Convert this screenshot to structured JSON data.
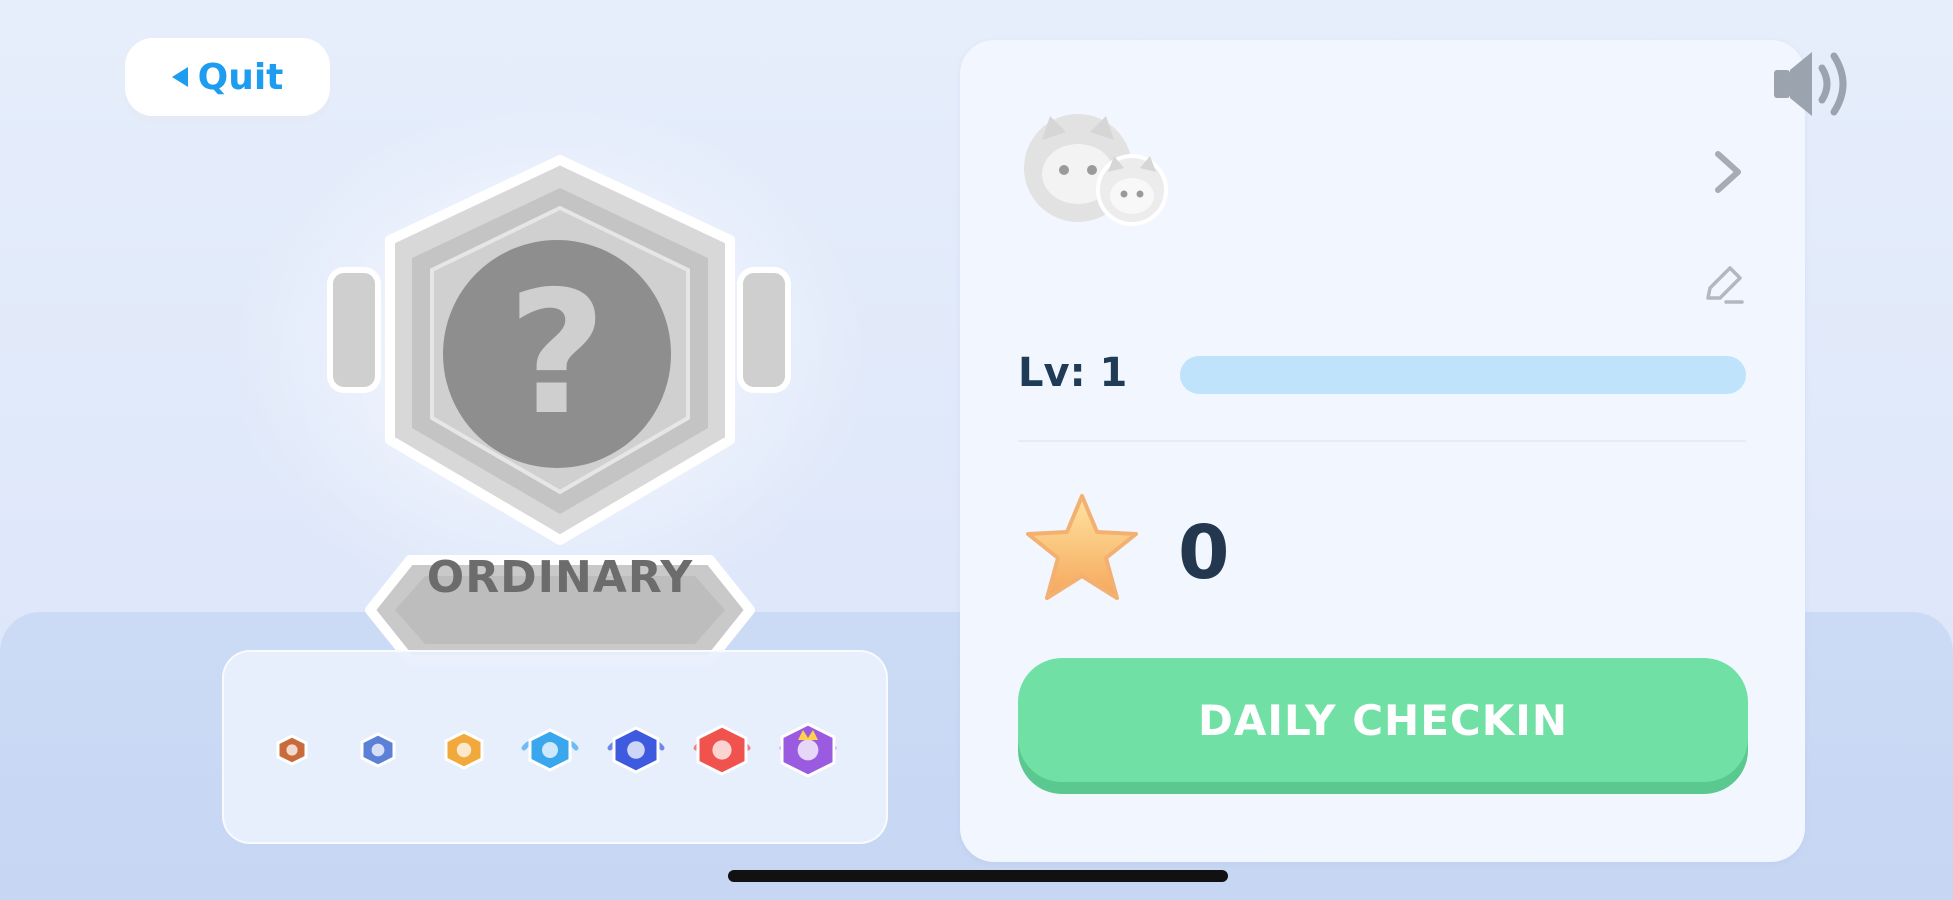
{
  "header": {
    "quit_label": "Quit"
  },
  "badge": {
    "tier_label": "ORDINARY",
    "icon": "question-mark-badge-icon"
  },
  "tiers": [
    {
      "icon": "bronze-tier-icon",
      "color": "#c86a3a"
    },
    {
      "icon": "silver-tier-icon",
      "color": "#5c7fd8"
    },
    {
      "icon": "gold-tier-icon",
      "color": "#f1a93b"
    },
    {
      "icon": "platinum-tier-icon",
      "color": "#3aa6ee"
    },
    {
      "icon": "diamond-tier-icon",
      "color": "#3e5be0"
    },
    {
      "icon": "master-tier-icon",
      "color": "#f0534e"
    },
    {
      "icon": "king-tier-icon",
      "color": "#9a5be0"
    }
  ],
  "profile": {
    "level_label": "Lv: 1",
    "level_progress": 0,
    "stars": "0",
    "checkin_label": "DAILY CHECKIN"
  },
  "colors": {
    "accent_blue": "#1e9cf0",
    "checkin_green": "#70e0a4",
    "level_track": "#bfe3fb",
    "text_dark": "#23384f"
  }
}
